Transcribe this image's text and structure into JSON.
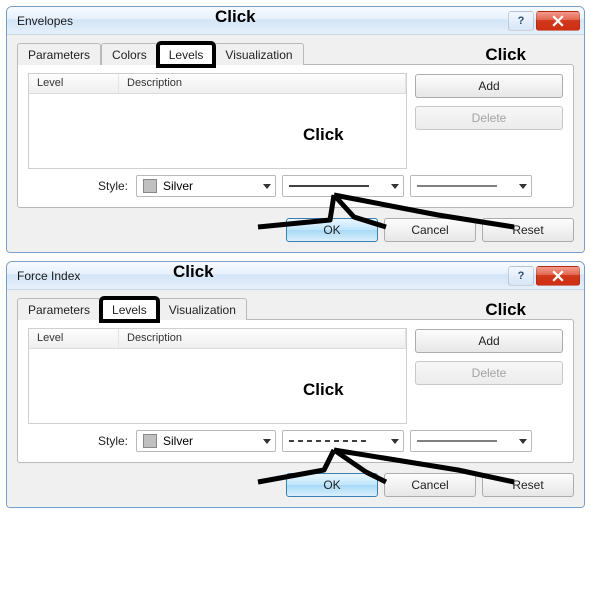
{
  "dialogs": [
    {
      "title": "Envelopes",
      "tabs": [
        "Parameters",
        "Colors",
        "Levels",
        "Visualization"
      ],
      "active_tab_index": 2,
      "highlight_tab_index": 2,
      "columns": {
        "level": "Level",
        "description": "Description"
      },
      "side": {
        "add": "Add",
        "delete": "Delete"
      },
      "style": {
        "label": "Style:",
        "color_name": "Silver",
        "color_hex": "#c0c0c0",
        "linestyle": "solid",
        "linewidth": "thin"
      },
      "footer": {
        "ok": "OK",
        "cancel": "Cancel",
        "reset": "Reset"
      },
      "annotations": {
        "tab_click": "Click",
        "add_click": "Click",
        "style_click": "Click"
      }
    },
    {
      "title": "Force Index",
      "tabs": [
        "Parameters",
        "Levels",
        "Visualization"
      ],
      "active_tab_index": 1,
      "highlight_tab_index": 1,
      "columns": {
        "level": "Level",
        "description": "Description"
      },
      "side": {
        "add": "Add",
        "delete": "Delete"
      },
      "style": {
        "label": "Style:",
        "color_name": "Silver",
        "color_hex": "#c0c0c0",
        "linestyle": "dashed",
        "linewidth": "thin"
      },
      "footer": {
        "ok": "OK",
        "cancel": "Cancel",
        "reset": "Reset"
      },
      "annotations": {
        "tab_click": "Click",
        "add_click": "Click",
        "style_click": "Click"
      }
    }
  ]
}
